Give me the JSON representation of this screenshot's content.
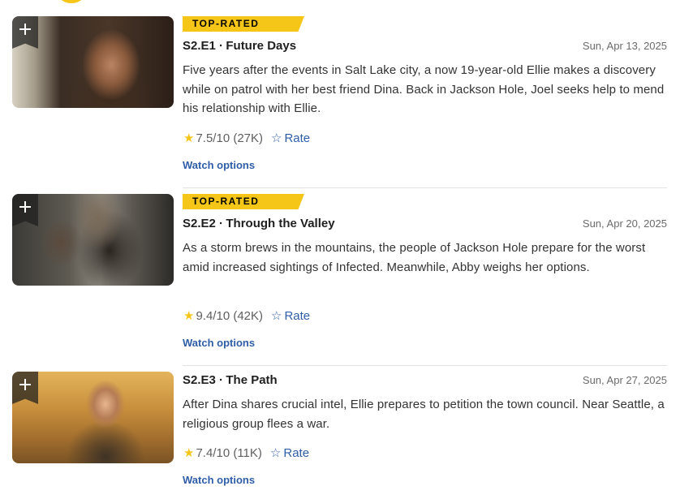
{
  "episodes": [
    {
      "badge": "TOP-RATED",
      "title": "S2.E1 ∙ Future Days",
      "date": "Sun, Apr 13, 2025",
      "description": "Five years after the events in Salt Lake city, a now 19-year-old Ellie makes a discovery while on patrol with her best friend Dina. Back in Jackson Hole, Joel seeks help to mend his relationship with Ellie.",
      "rating": "7.5/10 (27K)",
      "rate_label": "Rate",
      "watch_label": "Watch options"
    },
    {
      "badge": "TOP-RATED",
      "title": "S2.E2 ∙ Through the Valley",
      "date": "Sun, Apr 20, 2025",
      "description": "As a storm brews in the mountains, the people of Jackson Hole prepare for the worst amid increased sightings of Infected. Meanwhile, Abby weighs her options.",
      "rating": "9.4/10 (42K)",
      "rate_label": "Rate",
      "watch_label": "Watch options"
    },
    {
      "title": "S2.E3 ∙ The Path",
      "date": "Sun, Apr 27, 2025",
      "description": "After Dina shares crucial intel, Ellie prepares to petition the town council. Near Seattle, a religious group flees a war.",
      "rating": "7.4/10 (11K)",
      "rate_label": "Rate",
      "watch_label": "Watch options"
    }
  ],
  "icons": {
    "watchlist": "plus-icon",
    "rating": "star-icon",
    "rate": "star-outline-icon"
  },
  "colors": {
    "accent_yellow": "#f5c518",
    "link_blue": "#2f5ea8"
  }
}
